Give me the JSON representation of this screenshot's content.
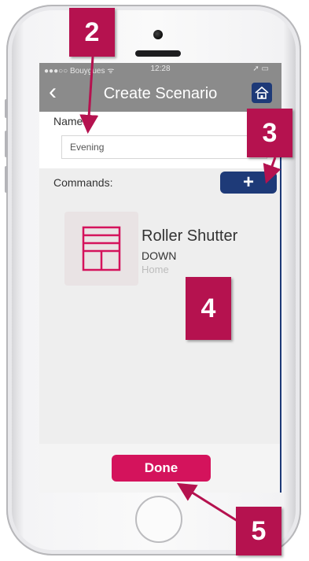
{
  "status_bar": {
    "carrier": "●●●○○ Bouygues ᯤ",
    "time": "12:28",
    "right": "➚ ▭"
  },
  "nav": {
    "back_icon": "‹",
    "title": "Create Scenario"
  },
  "form": {
    "name_label": "Name:",
    "name_value": "Evening"
  },
  "commands": {
    "label": "Commands:",
    "add_label": "+",
    "items": [
      {
        "title": "Roller Shutter",
        "state": "DOWN",
        "room": "Home",
        "icon": "roller-shutter-icon"
      }
    ]
  },
  "done_label": "Done",
  "callouts": {
    "c2": "2",
    "c3": "3",
    "c4": "4",
    "c5": "5"
  },
  "colors": {
    "accent": "#d4135c",
    "callout": "#b5124f",
    "navy": "#1e3a78",
    "navbar": "#8b8b8b"
  }
}
